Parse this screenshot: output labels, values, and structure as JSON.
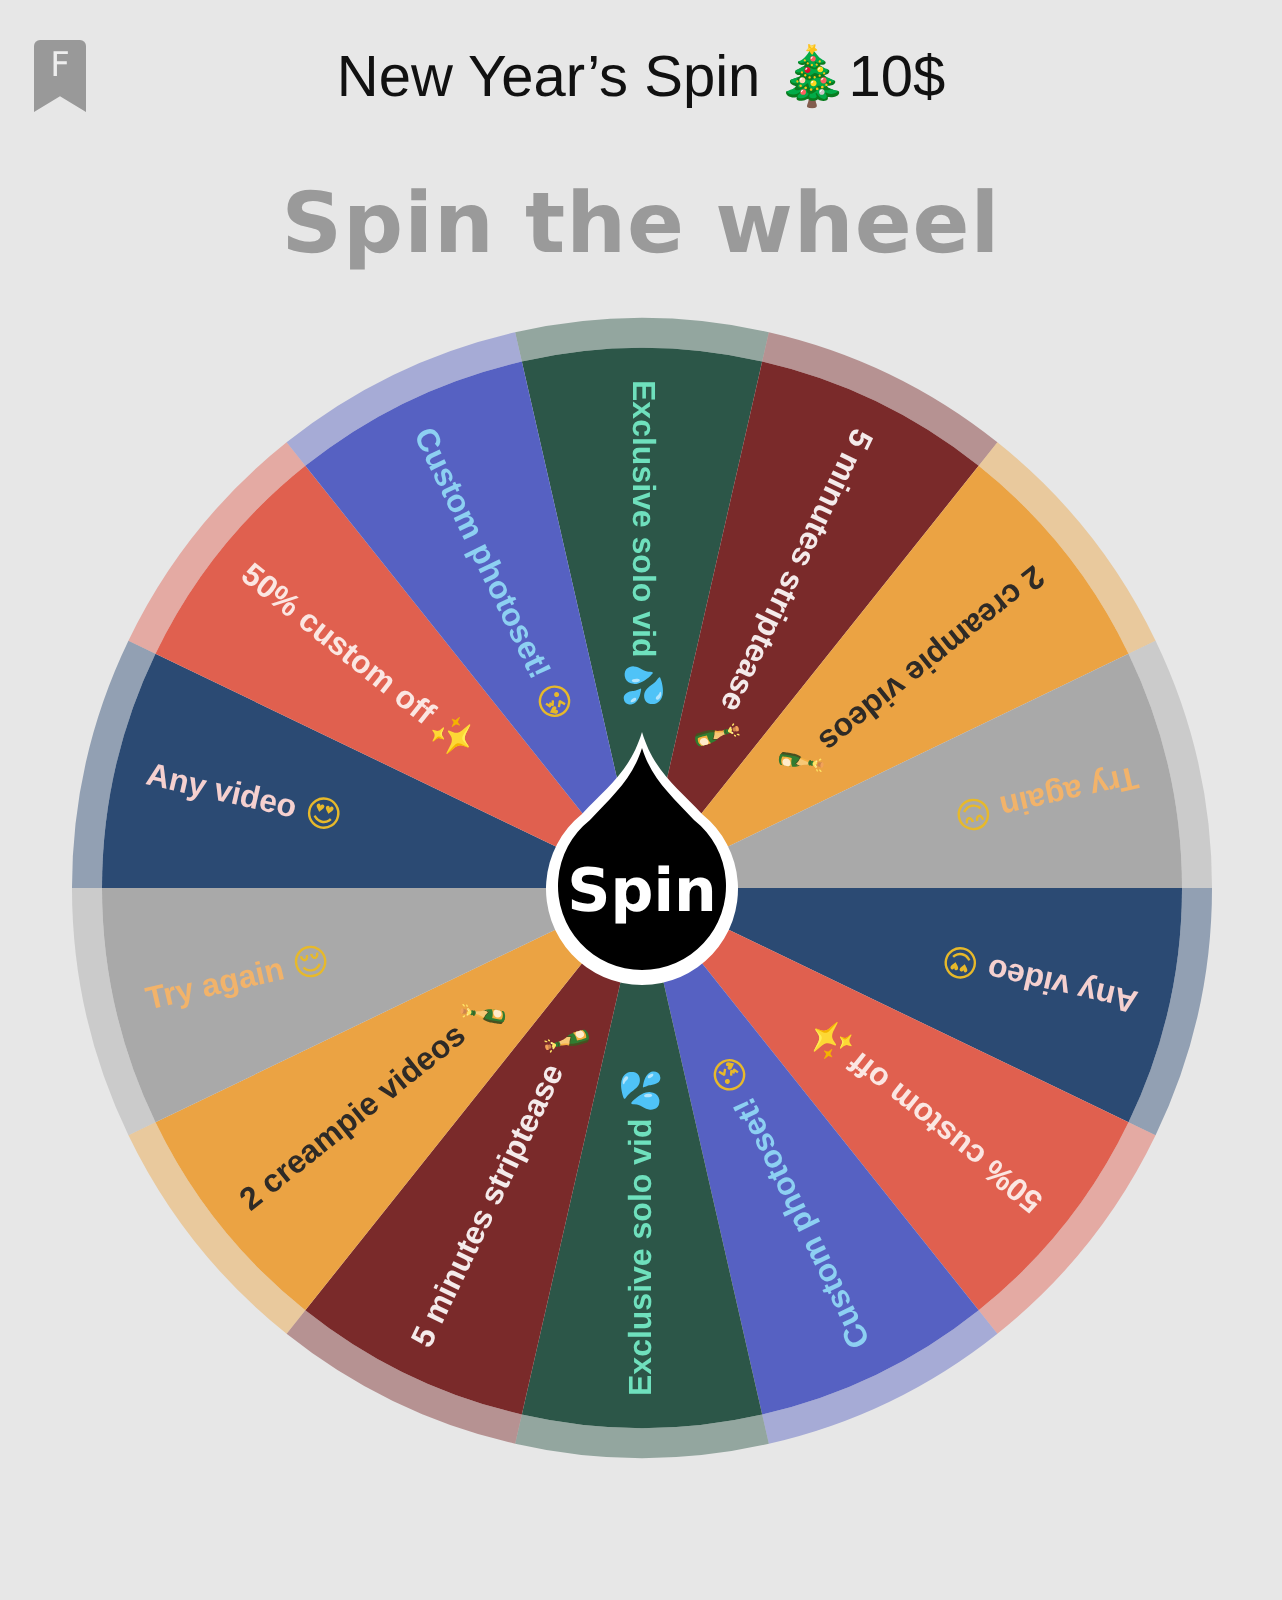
{
  "header": {
    "badge": "F",
    "title": "New Year’s Spin 🎄10$"
  },
  "heading": "Spin the wheel",
  "wheel": {
    "button": "Spin",
    "segments": [
      {
        "label": "Exclusive solo vid",
        "emoji": "💦",
        "color": "#2c5648"
      },
      {
        "label": "5 minutes striptease",
        "emoji": "🍾",
        "color": "#7a2a2a"
      },
      {
        "label": "2 creampie videos",
        "emoji": "🍾",
        "color": "#eba343"
      },
      {
        "label": "Try again",
        "emoji": "😌",
        "color": "#a9a9a9"
      },
      {
        "label": "Any video",
        "emoji": "😍",
        "color": "#2b4a73"
      },
      {
        "label": "50% custom off",
        "emoji": "✨",
        "color": "#e0604f"
      },
      {
        "label": "Custom photoset!",
        "emoji": "😘",
        "color": "#5661c2"
      },
      {
        "label": "Exclusive solo vid",
        "emoji": "💦",
        "color": "#2c5648"
      },
      {
        "label": "5 minutes striptease",
        "emoji": "🍾",
        "color": "#7a2a2a"
      },
      {
        "label": "2 creampie videos",
        "emoji": "🍾",
        "color": "#eba343"
      },
      {
        "label": "Try again",
        "emoji": "😌",
        "color": "#a9a9a9"
      },
      {
        "label": "Any video",
        "emoji": "😍",
        "color": "#2b4a73"
      },
      {
        "label": "50% custom off",
        "emoji": "✨",
        "color": "#e0604f"
      },
      {
        "label": "Custom photoset!",
        "emoji": "😘",
        "color": "#5661c2"
      }
    ]
  }
}
